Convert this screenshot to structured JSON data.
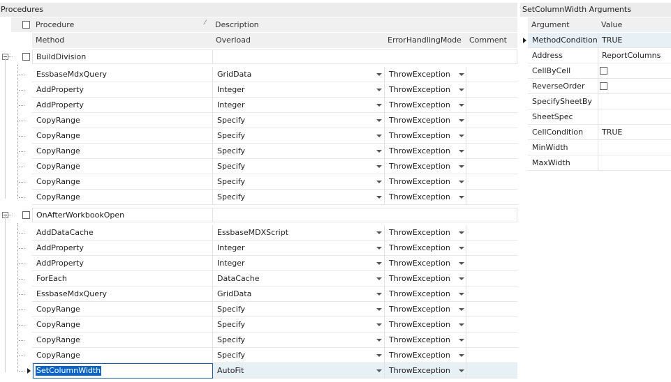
{
  "procedures_panel": {
    "title": "Procedures",
    "header_procedure": "Procedure",
    "header_description": "Description",
    "header_method": "Method",
    "header_overload": "Overload",
    "header_error_mode": "ErrorHandlingMode",
    "header_comment": "Comment",
    "groups": [
      {
        "name": "BuildDivision",
        "rows": [
          {
            "method": "EssbaseMdxQuery",
            "overload": "GridData",
            "mode": "ThrowException"
          },
          {
            "method": "AddProperty",
            "overload": "Integer",
            "mode": "ThrowException"
          },
          {
            "method": "AddProperty",
            "overload": "Integer",
            "mode": "ThrowException"
          },
          {
            "method": "CopyRange",
            "overload": "Specify",
            "mode": "ThrowException"
          },
          {
            "method": "CopyRange",
            "overload": "Specify",
            "mode": "ThrowException"
          },
          {
            "method": "CopyRange",
            "overload": "Specify",
            "mode": "ThrowException"
          },
          {
            "method": "CopyRange",
            "overload": "Specify",
            "mode": "ThrowException"
          },
          {
            "method": "CopyRange",
            "overload": "Specify",
            "mode": "ThrowException"
          },
          {
            "method": "CopyRange",
            "overload": "Specify",
            "mode": "ThrowException"
          }
        ]
      },
      {
        "name": "OnAfterWorkbookOpen",
        "rows": [
          {
            "method": "AddDataCache",
            "overload": "EssbaseMDXScript",
            "mode": "ThrowException"
          },
          {
            "method": "AddProperty",
            "overload": "Integer",
            "mode": "ThrowException"
          },
          {
            "method": "AddProperty",
            "overload": "Integer",
            "mode": "ThrowException"
          },
          {
            "method": "ForEach",
            "overload": "DataCache",
            "mode": "ThrowException"
          },
          {
            "method": "EssbaseMdxQuery",
            "overload": "GridData",
            "mode": "ThrowException"
          },
          {
            "method": "CopyRange",
            "overload": "Specify",
            "mode": "ThrowException"
          },
          {
            "method": "CopyRange",
            "overload": "Specify",
            "mode": "ThrowException"
          },
          {
            "method": "CopyRange",
            "overload": "Specify",
            "mode": "ThrowException"
          },
          {
            "method": "CopyRange",
            "overload": "Specify",
            "mode": "ThrowException"
          },
          {
            "method": "SetColumnWidth",
            "overload": "AutoFit",
            "mode": "ThrowException",
            "selected": true
          }
        ]
      }
    ]
  },
  "arguments_panel": {
    "title": "SetColumnWidth Arguments",
    "header_argument": "Argument",
    "header_value": "Value",
    "rows": [
      {
        "argument": "MethodCondition",
        "value": "TRUE",
        "type": "text",
        "current": true
      },
      {
        "argument": "Address",
        "value": "ReportColumns",
        "type": "text"
      },
      {
        "argument": "CellByCell",
        "value": "",
        "type": "checkbox"
      },
      {
        "argument": "ReverseOrder",
        "value": "",
        "type": "checkbox"
      },
      {
        "argument": "SpecifySheetBy",
        "value": "",
        "type": "text"
      },
      {
        "argument": "SheetSpec",
        "value": "",
        "type": "text"
      },
      {
        "argument": "CellCondition",
        "value": "TRUE",
        "type": "text"
      },
      {
        "argument": "MinWidth",
        "value": "",
        "type": "text"
      },
      {
        "argument": "MaxWidth",
        "value": "",
        "type": "text"
      }
    ]
  },
  "colors": {
    "title_bg": "#ececec",
    "header_bg": "#f0f0f0",
    "selected_row_bg": "#e6f0f5",
    "selection_text_bg": "#0a64c8",
    "editor_border": "#1e5aa0"
  }
}
